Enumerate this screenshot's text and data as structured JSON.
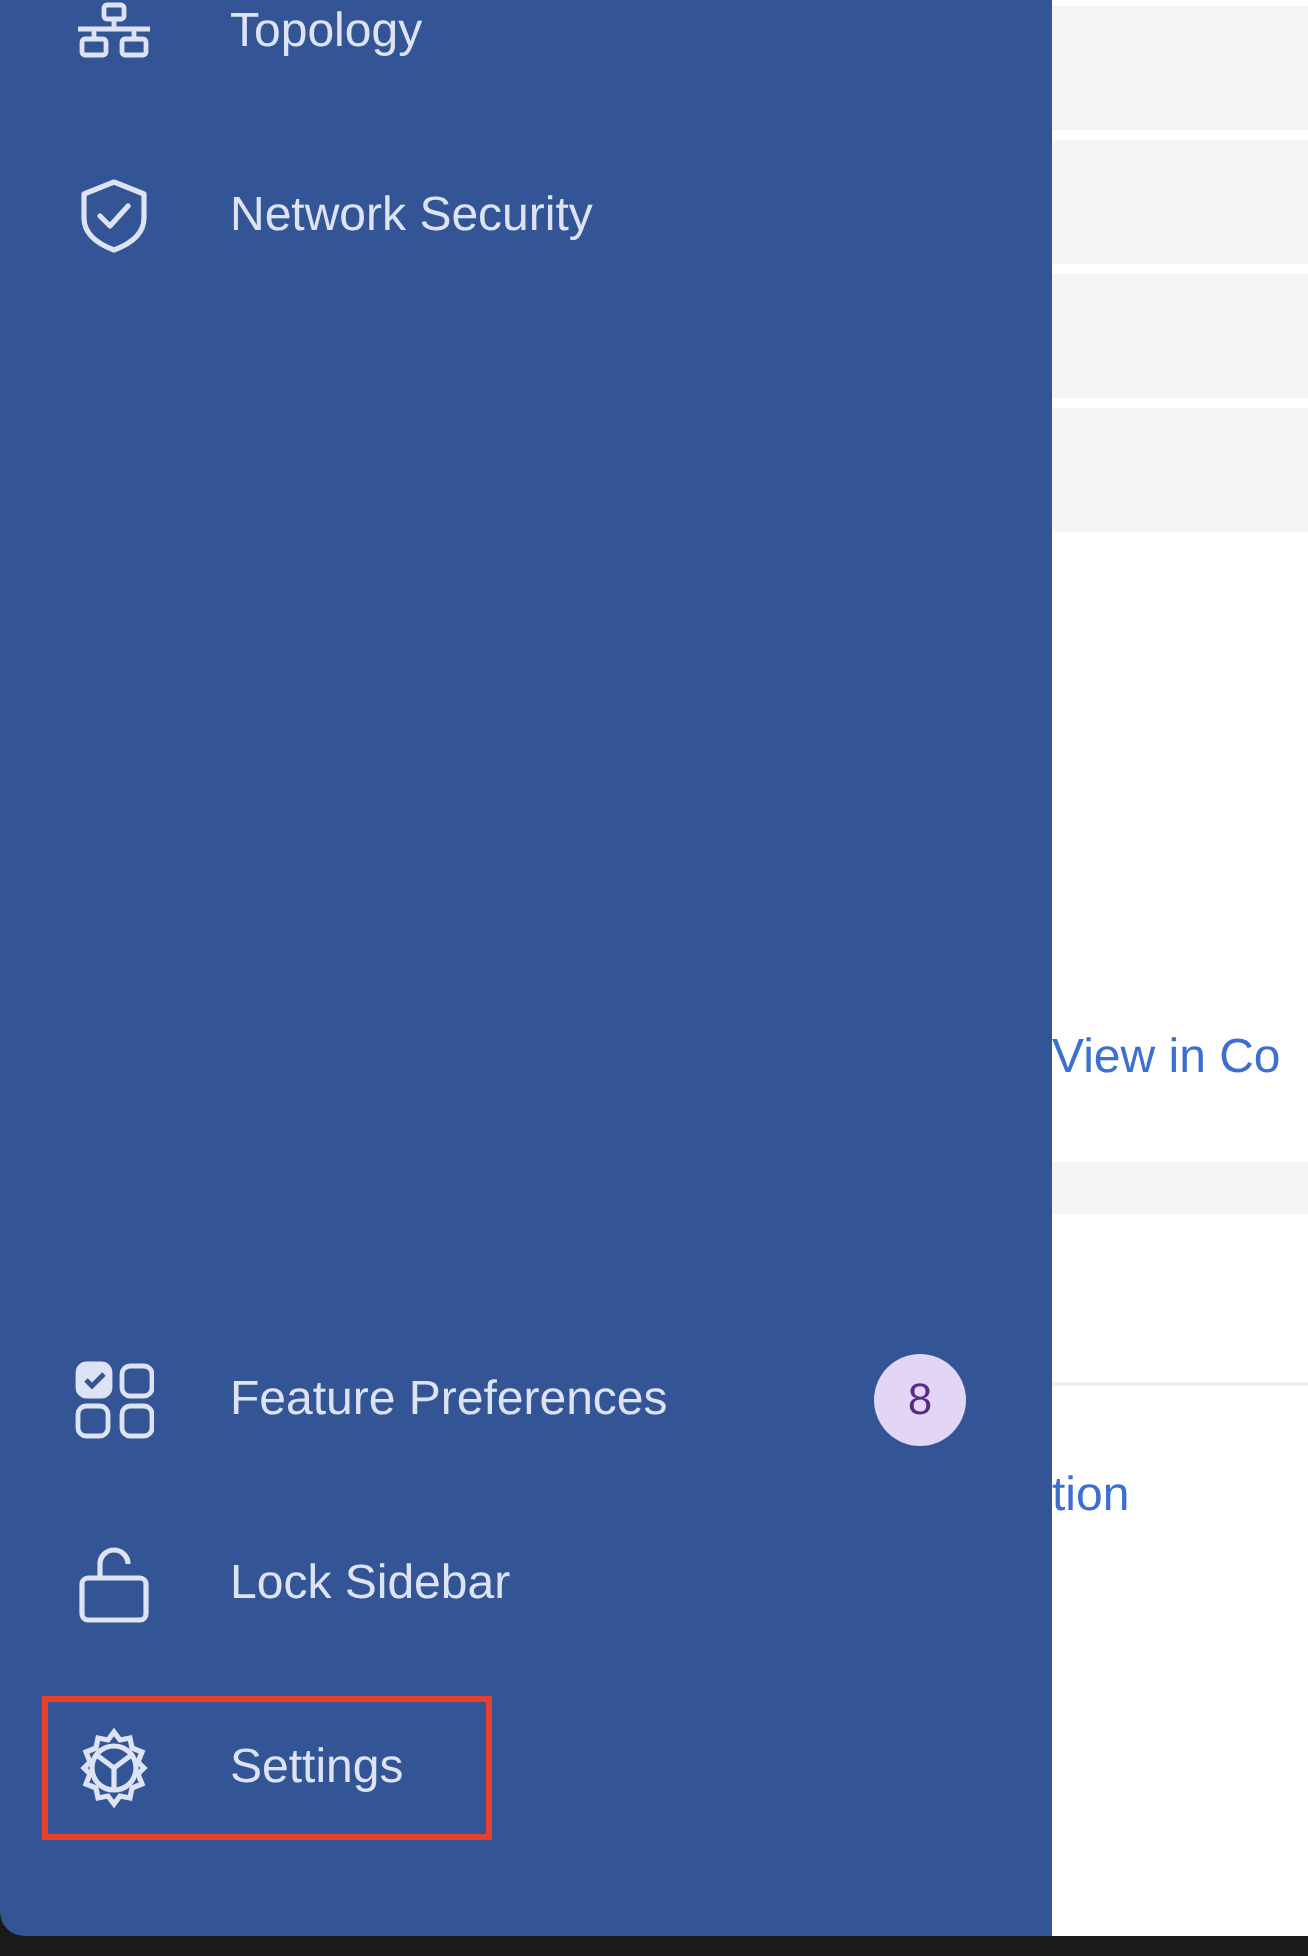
{
  "sidebar": {
    "top_items": [
      {
        "kind": "topology",
        "label": "Topology",
        "highlighted": false
      },
      {
        "kind": "shield",
        "label": "Network Security",
        "highlighted": false
      }
    ],
    "bottom_items": [
      {
        "kind": "features",
        "label": "Feature Preferences",
        "badge": "8",
        "highlighted": false
      },
      {
        "kind": "lock",
        "label": "Lock Sidebar",
        "highlighted": false
      },
      {
        "kind": "settings",
        "label": "Settings",
        "highlighted": true
      }
    ]
  },
  "main": {
    "links": [
      "View in Co",
      "tion"
    ]
  }
}
